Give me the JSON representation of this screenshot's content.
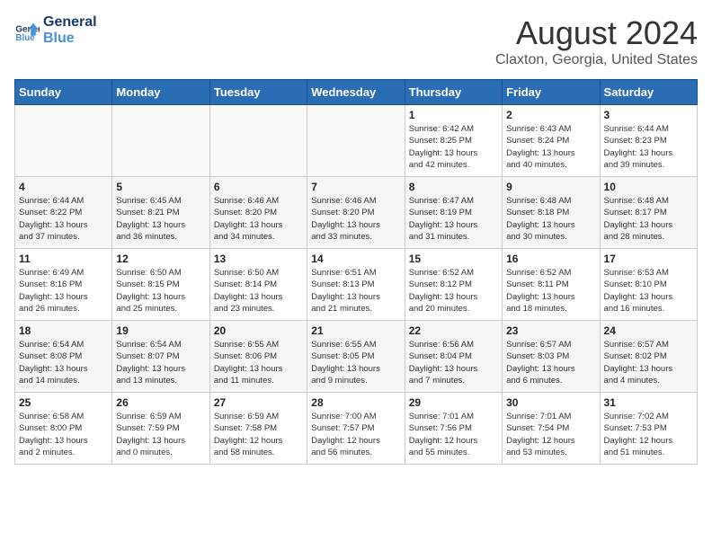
{
  "logo": {
    "line1": "General",
    "line2": "Blue"
  },
  "title": "August 2024",
  "subtitle": "Claxton, Georgia, United States",
  "days_of_week": [
    "Sunday",
    "Monday",
    "Tuesday",
    "Wednesday",
    "Thursday",
    "Friday",
    "Saturday"
  ],
  "weeks": [
    [
      {
        "day": "",
        "info": ""
      },
      {
        "day": "",
        "info": ""
      },
      {
        "day": "",
        "info": ""
      },
      {
        "day": "",
        "info": ""
      },
      {
        "day": "1",
        "info": "Sunrise: 6:42 AM\nSunset: 8:25 PM\nDaylight: 13 hours\nand 42 minutes."
      },
      {
        "day": "2",
        "info": "Sunrise: 6:43 AM\nSunset: 8:24 PM\nDaylight: 13 hours\nand 40 minutes."
      },
      {
        "day": "3",
        "info": "Sunrise: 6:44 AM\nSunset: 8:23 PM\nDaylight: 13 hours\nand 39 minutes."
      }
    ],
    [
      {
        "day": "4",
        "info": "Sunrise: 6:44 AM\nSunset: 8:22 PM\nDaylight: 13 hours\nand 37 minutes."
      },
      {
        "day": "5",
        "info": "Sunrise: 6:45 AM\nSunset: 8:21 PM\nDaylight: 13 hours\nand 36 minutes."
      },
      {
        "day": "6",
        "info": "Sunrise: 6:46 AM\nSunset: 8:20 PM\nDaylight: 13 hours\nand 34 minutes."
      },
      {
        "day": "7",
        "info": "Sunrise: 6:46 AM\nSunset: 8:20 PM\nDaylight: 13 hours\nand 33 minutes."
      },
      {
        "day": "8",
        "info": "Sunrise: 6:47 AM\nSunset: 8:19 PM\nDaylight: 13 hours\nand 31 minutes."
      },
      {
        "day": "9",
        "info": "Sunrise: 6:48 AM\nSunset: 8:18 PM\nDaylight: 13 hours\nand 30 minutes."
      },
      {
        "day": "10",
        "info": "Sunrise: 6:48 AM\nSunset: 8:17 PM\nDaylight: 13 hours\nand 28 minutes."
      }
    ],
    [
      {
        "day": "11",
        "info": "Sunrise: 6:49 AM\nSunset: 8:16 PM\nDaylight: 13 hours\nand 26 minutes."
      },
      {
        "day": "12",
        "info": "Sunrise: 6:50 AM\nSunset: 8:15 PM\nDaylight: 13 hours\nand 25 minutes."
      },
      {
        "day": "13",
        "info": "Sunrise: 6:50 AM\nSunset: 8:14 PM\nDaylight: 13 hours\nand 23 minutes."
      },
      {
        "day": "14",
        "info": "Sunrise: 6:51 AM\nSunset: 8:13 PM\nDaylight: 13 hours\nand 21 minutes."
      },
      {
        "day": "15",
        "info": "Sunrise: 6:52 AM\nSunset: 8:12 PM\nDaylight: 13 hours\nand 20 minutes."
      },
      {
        "day": "16",
        "info": "Sunrise: 6:52 AM\nSunset: 8:11 PM\nDaylight: 13 hours\nand 18 minutes."
      },
      {
        "day": "17",
        "info": "Sunrise: 6:53 AM\nSunset: 8:10 PM\nDaylight: 13 hours\nand 16 minutes."
      }
    ],
    [
      {
        "day": "18",
        "info": "Sunrise: 6:54 AM\nSunset: 8:08 PM\nDaylight: 13 hours\nand 14 minutes."
      },
      {
        "day": "19",
        "info": "Sunrise: 6:54 AM\nSunset: 8:07 PM\nDaylight: 13 hours\nand 13 minutes."
      },
      {
        "day": "20",
        "info": "Sunrise: 6:55 AM\nSunset: 8:06 PM\nDaylight: 13 hours\nand 11 minutes."
      },
      {
        "day": "21",
        "info": "Sunrise: 6:55 AM\nSunset: 8:05 PM\nDaylight: 13 hours\nand 9 minutes."
      },
      {
        "day": "22",
        "info": "Sunrise: 6:56 AM\nSunset: 8:04 PM\nDaylight: 13 hours\nand 7 minutes."
      },
      {
        "day": "23",
        "info": "Sunrise: 6:57 AM\nSunset: 8:03 PM\nDaylight: 13 hours\nand 6 minutes."
      },
      {
        "day": "24",
        "info": "Sunrise: 6:57 AM\nSunset: 8:02 PM\nDaylight: 13 hours\nand 4 minutes."
      }
    ],
    [
      {
        "day": "25",
        "info": "Sunrise: 6:58 AM\nSunset: 8:00 PM\nDaylight: 13 hours\nand 2 minutes."
      },
      {
        "day": "26",
        "info": "Sunrise: 6:59 AM\nSunset: 7:59 PM\nDaylight: 13 hours\nand 0 minutes."
      },
      {
        "day": "27",
        "info": "Sunrise: 6:59 AM\nSunset: 7:58 PM\nDaylight: 12 hours\nand 58 minutes."
      },
      {
        "day": "28",
        "info": "Sunrise: 7:00 AM\nSunset: 7:57 PM\nDaylight: 12 hours\nand 56 minutes."
      },
      {
        "day": "29",
        "info": "Sunrise: 7:01 AM\nSunset: 7:56 PM\nDaylight: 12 hours\nand 55 minutes."
      },
      {
        "day": "30",
        "info": "Sunrise: 7:01 AM\nSunset: 7:54 PM\nDaylight: 12 hours\nand 53 minutes."
      },
      {
        "day": "31",
        "info": "Sunrise: 7:02 AM\nSunset: 7:53 PM\nDaylight: 12 hours\nand 51 minutes."
      }
    ]
  ]
}
